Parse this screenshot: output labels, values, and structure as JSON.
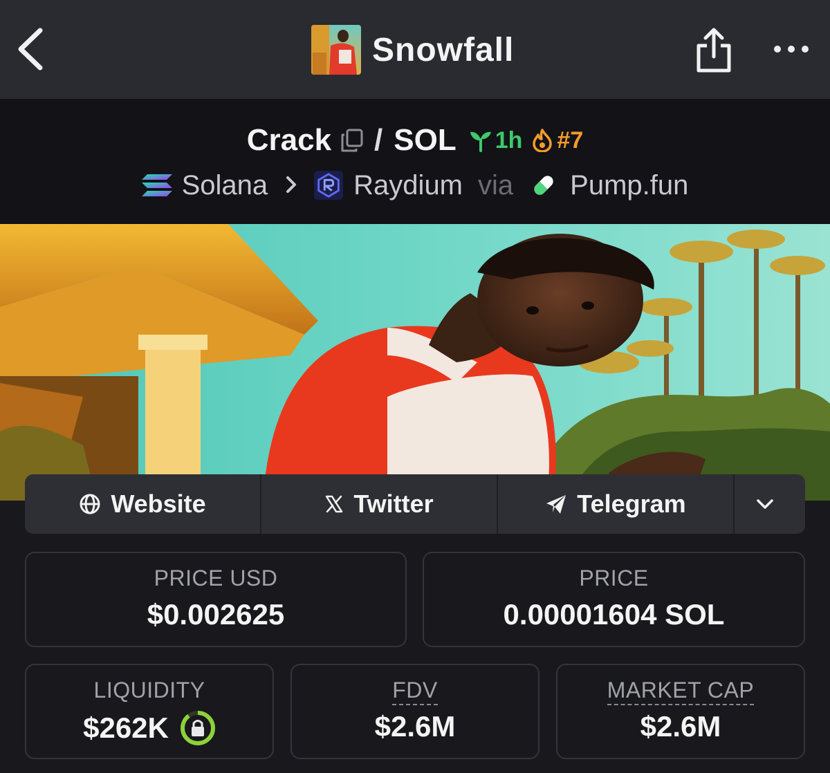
{
  "header": {
    "title": "Snowfall",
    "back_icon": "chevron-left-icon",
    "share_icon": "share-icon",
    "more_icon": "more-dots-icon"
  },
  "pair": {
    "base": "Crack",
    "separator": "/",
    "quote": "SOL",
    "age": "1h",
    "rank": "#7",
    "age_color": "#3ec96a",
    "rank_color": "#f39c2b"
  },
  "route": {
    "chain": "Solana",
    "dex": "Raydium",
    "via_label": "via",
    "launchpad": "Pump.fun"
  },
  "links": {
    "website": "Website",
    "twitter": "Twitter",
    "telegram": "Telegram"
  },
  "stats": {
    "price_usd_label": "PRICE USD",
    "price_usd_value": "$0.002625",
    "price_label": "PRICE",
    "price_value": "0.00001604 SOL",
    "liquidity_label": "LIQUIDITY",
    "liquidity_value": "$262K",
    "fdv_label": "FDV",
    "fdv_value": "$2.6M",
    "mcap_label": "MARKET CAP",
    "mcap_value": "$2.6M"
  }
}
